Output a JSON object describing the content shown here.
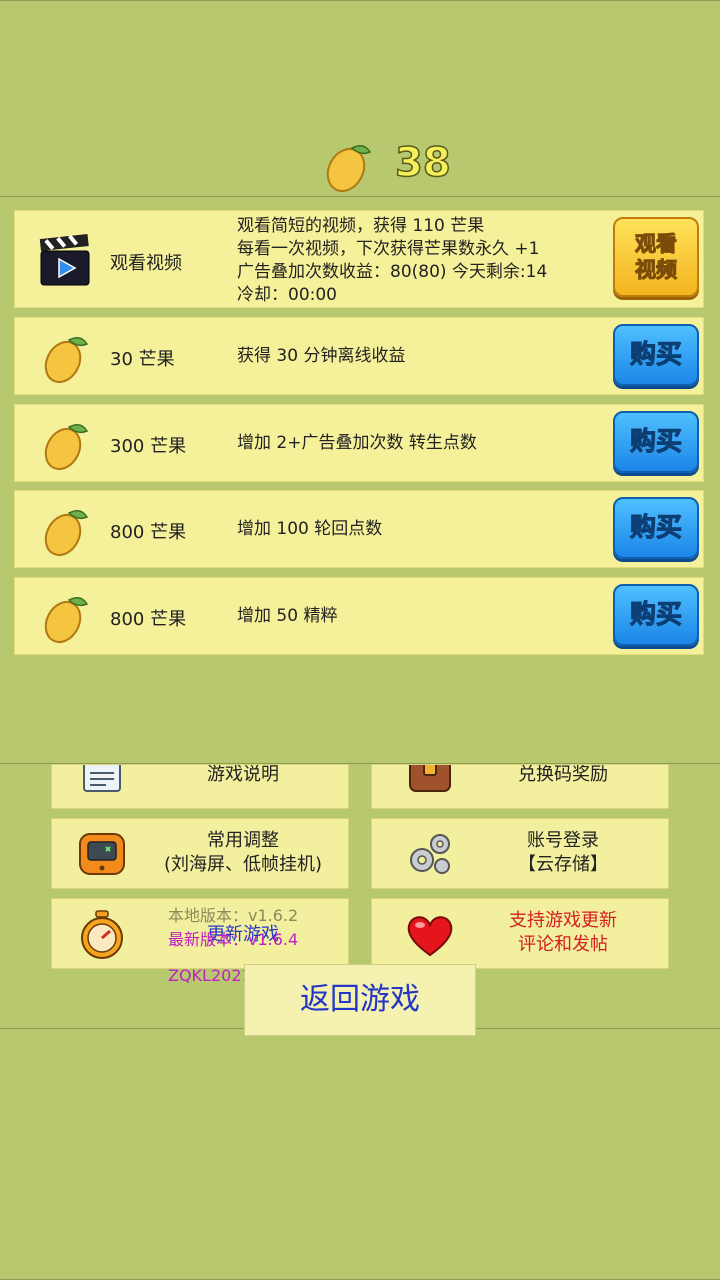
{
  "header": {
    "mango_count": "38"
  },
  "video_row": {
    "title": "观看视频",
    "line1": "观看简短的视频，获得 110 芒果",
    "line2": "每看一次视频，下次获得芒果数永久 +1",
    "line3": "广告叠加次数收益：80(80)   今天剩余:14",
    "line4": "冷却：00:00",
    "button_line1": "观看",
    "button_line2": "视频"
  },
  "shop_rows": [
    {
      "title": "30 芒果",
      "desc": "获得 30 分钟离线收益",
      "button": "购买"
    },
    {
      "title": "300 芒果",
      "desc": "增加 2+广告叠加次数 转生点数",
      "button": "购买"
    },
    {
      "title": "800 芒果",
      "desc": "增加 100 轮回点数",
      "button": "购买"
    },
    {
      "title": "800 芒果",
      "desc": "增加 50 精粹",
      "button": "购买"
    }
  ],
  "menu": {
    "game_help": "游戏说明",
    "redeem_code": "兑换码奖励",
    "settings_line1": "常用调整",
    "settings_line2": "(刘海屏、低帧挂机)",
    "login_line1": "账号登录",
    "login_line2": "【云存储】",
    "update_game": "更新游戏",
    "support_line1": "支持游戏更新",
    "support_line2": "评论和发帖"
  },
  "version": {
    "local": "本地版本：v1.6.2",
    "latest": "最新版本：v1.6.4",
    "code": "ZQKL2021"
  },
  "back_button": "返回游戏",
  "colors": {
    "background": "#b7c86f",
    "row_bg": "#f5f19a",
    "buy_button": "#1b86e8",
    "watch_button": "#f3b31e",
    "latest_version": "#c020c0",
    "support_text": "#d42020",
    "back_text": "#2436c8"
  }
}
